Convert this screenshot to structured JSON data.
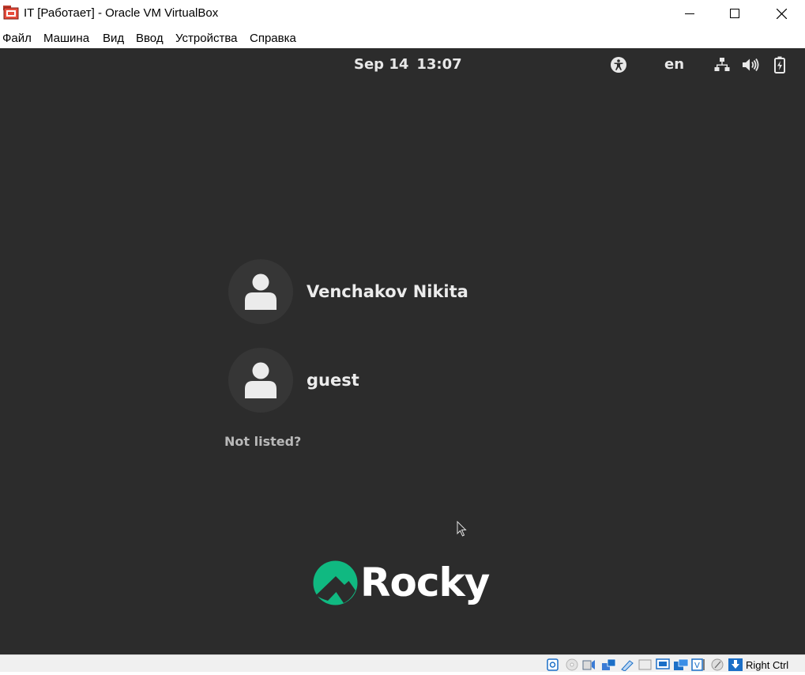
{
  "window": {
    "title": "IT [Работает] - Oracle VM VirtualBox",
    "icon": "virtualbox-app-icon",
    "buttons": {
      "minimize": "minimize-icon",
      "maximize": "maximize-icon",
      "close": "close-icon"
    }
  },
  "menu": {
    "items": [
      "Файл",
      "Машина",
      "Вид",
      "Ввод",
      "Устройства",
      "Справка"
    ]
  },
  "gnome": {
    "topbar": {
      "date": "Sep 14",
      "time": "13:07",
      "language": "en",
      "icons": [
        "accessibility-icon",
        "network-wired-icon",
        "volume-icon",
        "battery-icon"
      ]
    },
    "users": [
      {
        "name": "Venchakov Nikita",
        "avatar_icon": "user-avatar-icon"
      },
      {
        "name": "guest",
        "avatar_icon": "user-avatar-icon"
      }
    ],
    "not_listed": "Not listed?",
    "logo": {
      "text": "Rocky",
      "mark_color": "#10b981"
    }
  },
  "statusbar": {
    "icons": [
      "hard-disk-icon",
      "optical-drive-icon",
      "audio-icon",
      "network-icon",
      "usb-icon",
      "shared-folders-icon",
      "display-icon",
      "video-capture-icon",
      "cpu-icon",
      "mouse-integration-icon",
      "keyboard-capture-icon"
    ],
    "host_key": "Right Ctrl"
  },
  "colors": {
    "vm_background": "#2c2c2c",
    "avatar_background": "#363636",
    "rocky_green": "#10b981"
  }
}
